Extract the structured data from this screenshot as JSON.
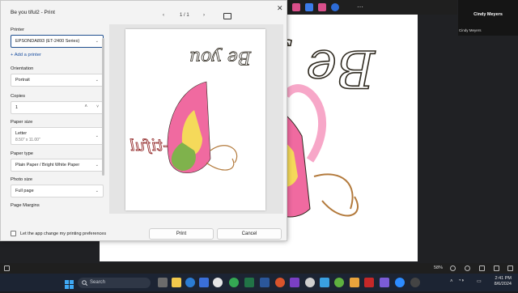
{
  "dialog": {
    "title": "Be you tiful2 - Print",
    "close": "✕",
    "nav": {
      "prev": "‹",
      "page": "1 / 1",
      "next": "›"
    },
    "printer": {
      "label": "Printer",
      "value": "EPSONDA893 (ET-2400 Series)"
    },
    "add_printer": "Add a printer",
    "orientation": {
      "label": "Orientation",
      "value": "Portrait"
    },
    "copies": {
      "label": "Copies",
      "value": "1"
    },
    "paper_size": {
      "label": "Paper size",
      "value": "Letter",
      "sub": "8.50\" x 11.00\""
    },
    "paper_type": {
      "label": "Paper type",
      "value": "Plain Paper / Bright White Paper"
    },
    "photo_size": {
      "label": "Photo size",
      "value": "Full page"
    },
    "page_margins": {
      "label": "Page Margins"
    },
    "preferences_checkbox": "Let the app change my printing preferences",
    "print_button": "Print",
    "cancel_button": "Cancel"
  },
  "participant": {
    "name": "Cindy Meyers",
    "label": "Cindy Meyers"
  },
  "statusbar": {
    "zoom": "58%"
  },
  "taskbar": {
    "search_placeholder": "Search",
    "time": "2:41 PM",
    "date": "8/6/2024"
  },
  "artwork": {
    "text_main": "Be you",
    "text_tiful": "-tiful",
    "colors": {
      "wing": "#f06aa0",
      "wing_light": "#f7a7c8",
      "accent": "#f5d95a",
      "green": "#7fb24c",
      "outline": "#2f2a20"
    }
  }
}
